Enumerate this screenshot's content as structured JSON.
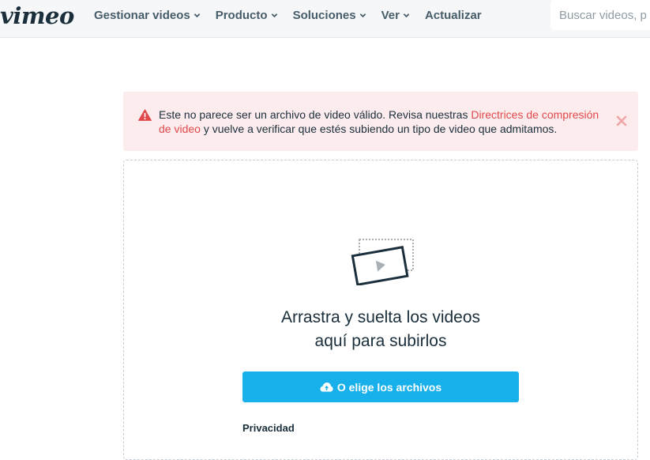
{
  "header": {
    "logo": "vimeo",
    "nav": [
      {
        "label": "Gestionar videos",
        "has_dropdown": true
      },
      {
        "label": "Producto",
        "has_dropdown": true
      },
      {
        "label": "Soluciones",
        "has_dropdown": true
      },
      {
        "label": "Ver",
        "has_dropdown": true
      },
      {
        "label": "Actualizar",
        "has_dropdown": false
      }
    ],
    "search_placeholder": "Buscar videos, p"
  },
  "alert": {
    "icon": "warning-icon",
    "text_before": "Este no parece ser un archivo de video válido. Revisa nuestras ",
    "link_text": "Directrices de compresión de video",
    "text_after": " y vuelve a verificar que estés subiendo un tipo de video que admitamos.",
    "close_icon": "close-icon",
    "color": "#e0494b"
  },
  "upload": {
    "title_line1": "Arrastra y suelta los videos",
    "title_line2": "aquí para subirlos",
    "button_label": "O elige los archivos",
    "button_icon": "cloud-upload-icon",
    "button_color": "#17b0ea",
    "privacy_label": "Privacidad"
  }
}
